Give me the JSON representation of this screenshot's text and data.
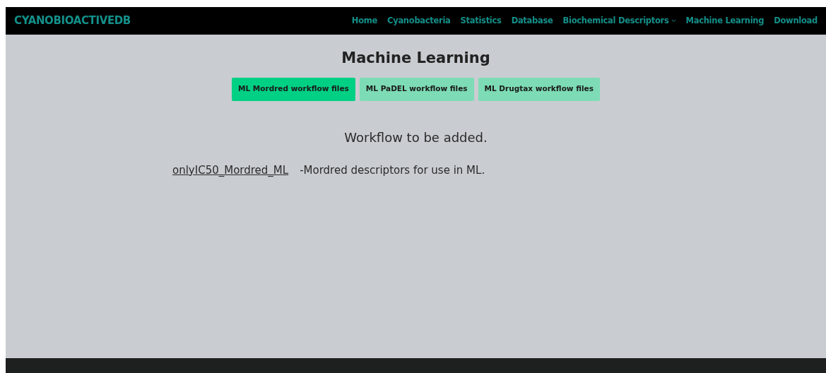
{
  "brand": "CYANOBIOACTIVEDB",
  "nav": [
    {
      "label": "Home",
      "kind": "link"
    },
    {
      "label": "Cyanobacteria",
      "kind": "link"
    },
    {
      "label": "Statistics",
      "kind": "link"
    },
    {
      "label": "Database",
      "kind": "link"
    },
    {
      "label": "Biochemical Descriptors",
      "kind": "dropdown"
    },
    {
      "label": "Machine Learning",
      "kind": "link"
    },
    {
      "label": "Download",
      "kind": "link"
    }
  ],
  "title": "Machine Learning",
  "tabs": [
    {
      "label": "ML Mordred workflow files",
      "selected": true
    },
    {
      "label": "ML PaDEL workflow files",
      "selected": false
    },
    {
      "label": "ML Drugtax workflow files",
      "selected": false
    }
  ],
  "message": "Workflow to be added.",
  "files": [
    {
      "link": "onlyIC50_Mordred_ML",
      "description": "-Mordred descriptors for use in ML."
    }
  ]
}
